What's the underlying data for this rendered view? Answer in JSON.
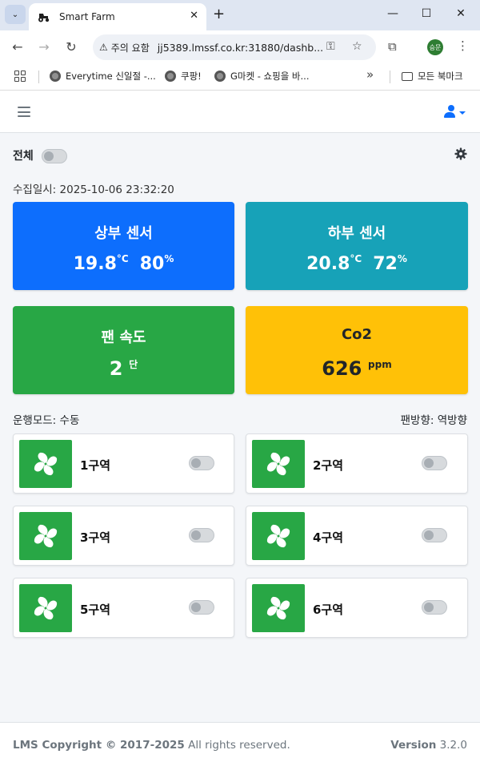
{
  "browser": {
    "tab_title": "Smart Farm",
    "security_label": "주의 요함",
    "url": "jj5389.lmssf.co.kr:31880/dashb...",
    "profile_initials": "승문",
    "bookmarks": [
      "Everytime 신일절 -...",
      "쿠팡!",
      "G마켓 - 쇼핑을 바...",
      "모든 북마크"
    ]
  },
  "controls": {
    "all_label": "전체",
    "all_on": false
  },
  "collected_at": "수집일시: 2025-10-06 23:32:20",
  "cards": {
    "upper": {
      "title": "상부 센서",
      "temp": "19.8",
      "temp_unit": "°C",
      "humidity": "80",
      "humidity_unit": "%",
      "color": "#0d6efd"
    },
    "lower": {
      "title": "하부 센서",
      "temp": "20.8",
      "temp_unit": "°C",
      "humidity": "72",
      "humidity_unit": "%",
      "color": "#17a2b8"
    },
    "fan": {
      "title": "팬 속도",
      "value": "2",
      "unit": "단",
      "color": "#28a745"
    },
    "co2": {
      "title": "Co2",
      "value": "626",
      "unit": "ppm",
      "color": "#ffc107"
    }
  },
  "status": {
    "mode": "운행모드: 수동",
    "fan_direction": "팬방향: 역방향"
  },
  "zones": [
    {
      "name": "1구역",
      "on": false
    },
    {
      "name": "2구역",
      "on": false
    },
    {
      "name": "3구역",
      "on": false
    },
    {
      "name": "4구역",
      "on": false
    },
    {
      "name": "5구역",
      "on": false
    },
    {
      "name": "6구역",
      "on": false
    }
  ],
  "icons": [
    "tractor-icon",
    "hamburger-icon",
    "user-icon",
    "gear-icon",
    "fan-icon"
  ],
  "footer": {
    "copyright": "LMS Copyright © 2017-2025",
    "rights": "All rights reserved.",
    "version_label": "Version",
    "version": "3.2.0"
  }
}
